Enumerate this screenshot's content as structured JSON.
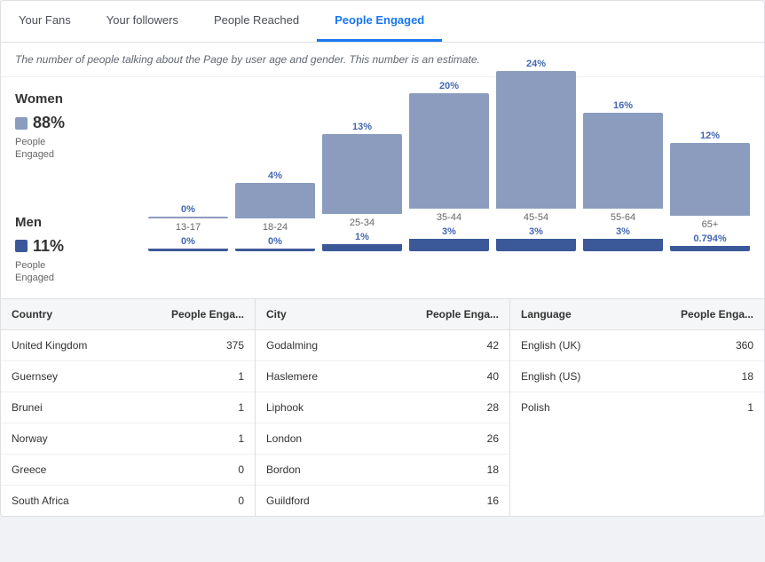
{
  "tabs": [
    {
      "label": "Your Fans",
      "active": false
    },
    {
      "label": "Your followers",
      "active": false
    },
    {
      "label": "People Reached",
      "active": false
    },
    {
      "label": "People Engaged",
      "active": true
    }
  ],
  "description": "The number of people talking about the Page by user age and gender. This number is an estimate.",
  "legend": {
    "women": {
      "title": "Women",
      "pct": "88%",
      "label": "People\nEngaged",
      "color": "women"
    },
    "men": {
      "title": "Men",
      "pct": "11%",
      "label": "People\nEngaged",
      "color": "men"
    }
  },
  "bars": [
    {
      "age": "13-17",
      "women_pct": "0%",
      "women_h": 2,
      "men_pct": "0%",
      "men_h": 3
    },
    {
      "age": "18-24",
      "women_pct": "4%",
      "women_h": 40,
      "men_pct": "0%",
      "men_h": 3
    },
    {
      "age": "25-34",
      "women_pct": "13%",
      "women_h": 90,
      "men_pct": "1%",
      "men_h": 8
    },
    {
      "age": "35-44",
      "women_pct": "20%",
      "women_h": 130,
      "men_pct": "3%",
      "men_h": 14
    },
    {
      "age": "45-54",
      "women_pct": "24%",
      "women_h": 155,
      "men_pct": "3%",
      "men_h": 14
    },
    {
      "age": "55-64",
      "women_pct": "16%",
      "women_h": 108,
      "men_pct": "3%",
      "men_h": 14
    },
    {
      "age": "65+",
      "women_pct": "12%",
      "women_h": 82,
      "men_pct": "0.794%",
      "men_h": 6
    }
  ],
  "tables": {
    "country": {
      "col1": "Country",
      "col2": "People Enga...",
      "rows": [
        {
          "name": "United Kingdom",
          "value": "375"
        },
        {
          "name": "Guernsey",
          "value": "1"
        },
        {
          "name": "Brunei",
          "value": "1"
        },
        {
          "name": "Norway",
          "value": "1"
        },
        {
          "name": "Greece",
          "value": "0"
        },
        {
          "name": "South Africa",
          "value": "0"
        }
      ]
    },
    "city": {
      "col1": "City",
      "col2": "People Enga...",
      "rows": [
        {
          "name": "Godalming",
          "value": "42"
        },
        {
          "name": "Haslemere",
          "value": "40"
        },
        {
          "name": "Liphook",
          "value": "28"
        },
        {
          "name": "London",
          "value": "26"
        },
        {
          "name": "Bordon",
          "value": "18"
        },
        {
          "name": "Guildford",
          "value": "16"
        }
      ]
    },
    "language": {
      "col1": "Language",
      "col2": "People Enga...",
      "rows": [
        {
          "name": "English (UK)",
          "value": "360"
        },
        {
          "name": "English (US)",
          "value": "18"
        },
        {
          "name": "Polish",
          "value": "1"
        }
      ]
    }
  }
}
